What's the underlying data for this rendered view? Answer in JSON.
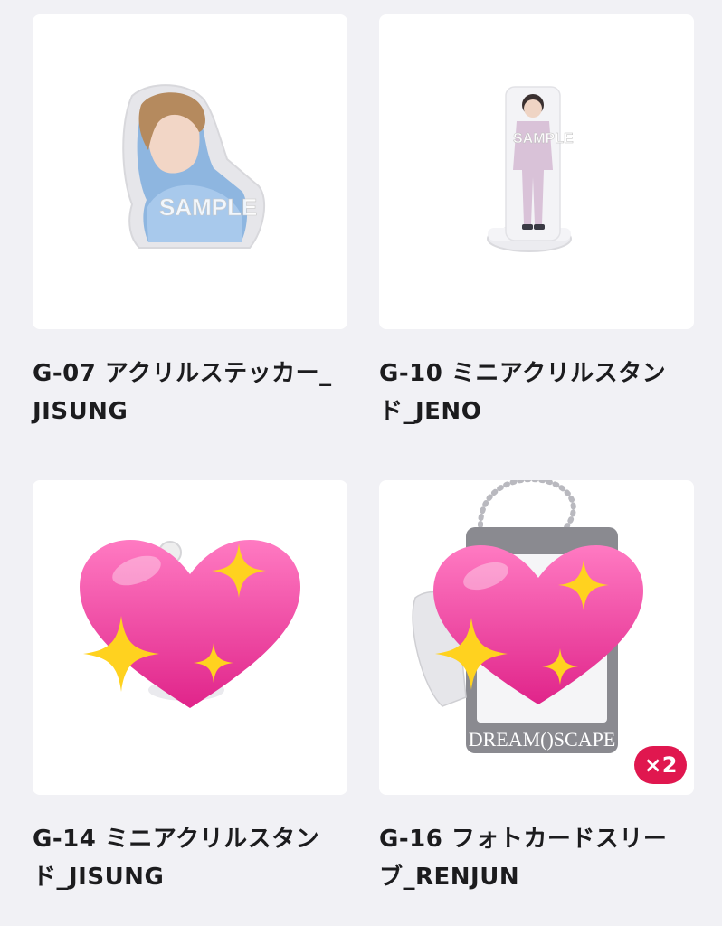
{
  "products": [
    {
      "title": "G-07 アクリルステッカー_JISUNG",
      "image_watermark": "SAMPLE"
    },
    {
      "title": "G-10 ミニアクリルスタンド_JENO",
      "image_watermark": "SAMPLE"
    },
    {
      "title": "G-14 ミニアクリルスタンド_JISUNG"
    },
    {
      "title": "G-16 フォトカードスリーブ_RENJUN",
      "image_brand": "DREAM()SCAPE",
      "quantity_badge": "×2"
    }
  ],
  "colors": {
    "background": "#f1f1f5",
    "card": "#ffffff",
    "badge": "#e0174f",
    "heart_emoji": "#f0459c",
    "sparkle_emoji": "#ffd21f"
  },
  "icons": [
    "sparkling-heart-emoji"
  ]
}
